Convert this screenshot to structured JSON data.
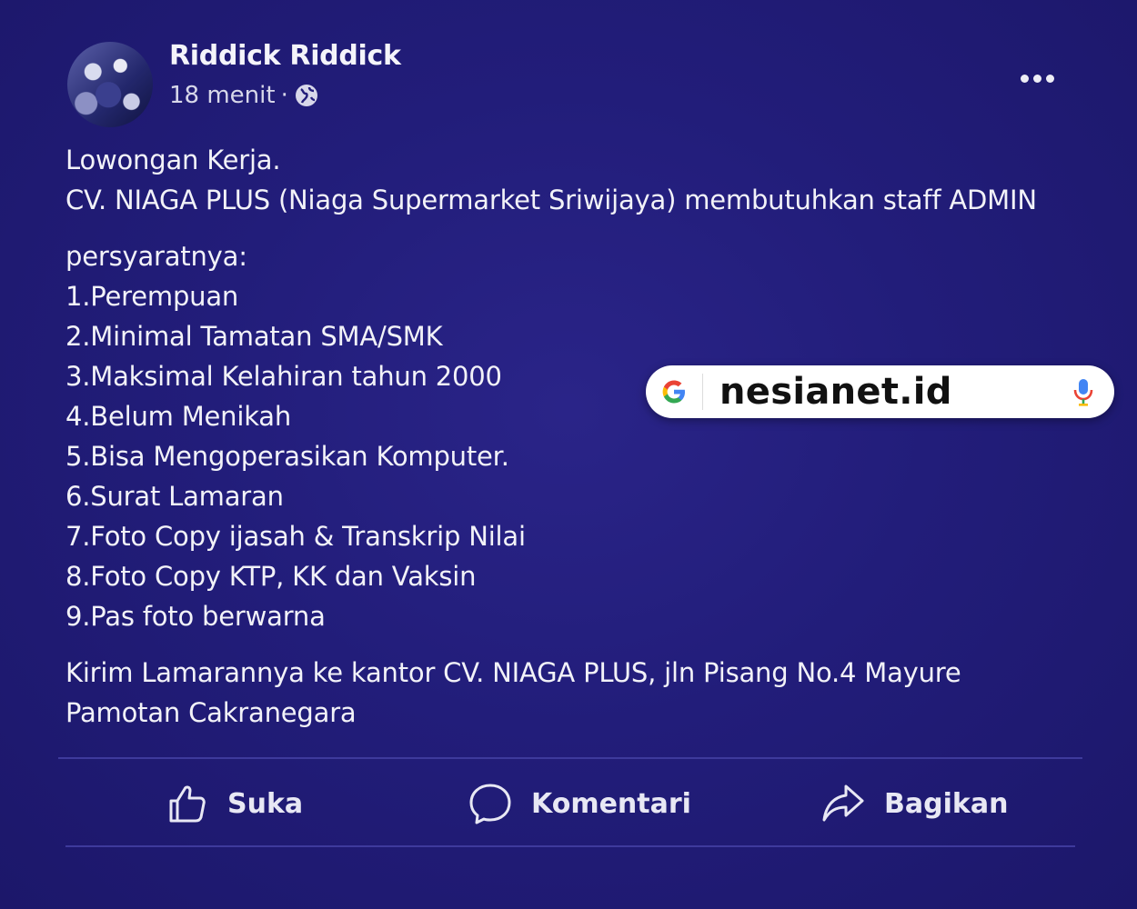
{
  "post": {
    "author": "Riddick Riddick",
    "time": "18 menit",
    "separator": "·",
    "content": {
      "lines_1": [
        "Lowongan Kerja.",
        "CV. NIAGA PLUS (Niaga Supermarket Sriwijaya) membutuhkan staff ADMIN"
      ],
      "lines_2": [
        "persyaratnya:",
        "1.Perempuan",
        "2.Minimal Tamatan SMA/SMK",
        "3.Maksimal Kelahiran tahun 2000",
        "4.Belum Menikah",
        "5.Bisa Mengoperasikan Komputer.",
        "6.Surat Lamaran",
        "7.Foto Copy ijasah & Transkrip Nilai",
        "8.Foto Copy KTP, KK dan Vaksin",
        "9.Pas foto berwarna"
      ],
      "lines_3": [
        "Kirim Lamarannya ke kantor CV. NIAGA PLUS, jln Pisang No.4 Mayure",
        "Pamotan Cakranegara"
      ]
    },
    "actions": {
      "like_label": "Suka",
      "comment_label": "Komentari",
      "share_label": "Bagikan"
    }
  },
  "watermark": {
    "search_text": "nesianet.id"
  },
  "icons": {
    "globe": "globe-icon",
    "more": "more-options-icon",
    "like": "thumbs-up-icon",
    "comment": "comment-bubble-icon",
    "share": "share-arrow-icon",
    "google": "google-g-icon",
    "mic": "microphone-icon"
  },
  "colors": {
    "background": "#221d7a",
    "text": "#f2f2f8",
    "divider": "#3e3a9c",
    "search_bg": "#ffffff"
  }
}
